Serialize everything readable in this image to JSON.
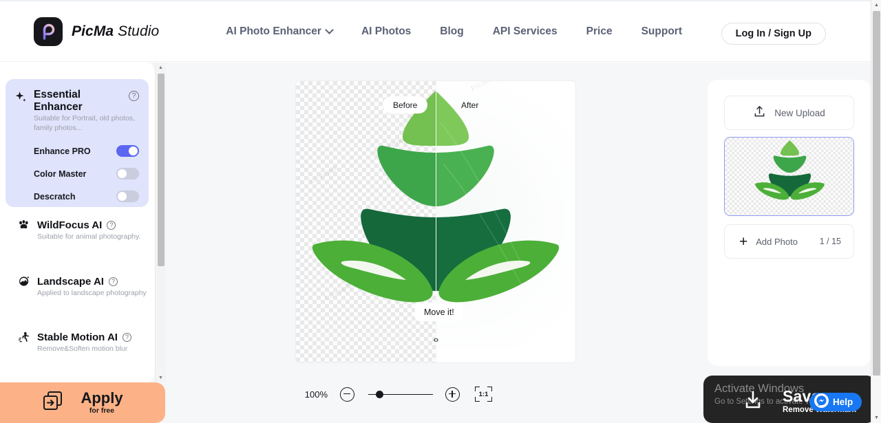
{
  "brand": {
    "name_bold": "PicMa",
    "name_light": "Studio",
    "logo_icon": "picma-p-logo-icon"
  },
  "nav": {
    "items": [
      {
        "label": "AI Photo Enhancer",
        "has_caret": true
      },
      {
        "label": "AI Photos",
        "has_caret": false
      },
      {
        "label": "Blog",
        "has_caret": false
      },
      {
        "label": "API Services",
        "has_caret": false
      },
      {
        "label": "Price",
        "has_caret": false
      },
      {
        "label": "Support",
        "has_caret": false
      }
    ],
    "login_label": "Log In / Sign Up"
  },
  "left_panel": {
    "essential": {
      "title": "Essential Enhancer",
      "subtitle": "Suitable for Portrait, old photos, family photos...",
      "help": "?",
      "toggles": [
        {
          "label": "Enhance PRO",
          "on": true
        },
        {
          "label": "Color Master",
          "on": false
        },
        {
          "label": "Descratch",
          "on": false
        }
      ]
    },
    "modes": [
      {
        "title": "WildFocus AI",
        "subtitle": "Suitable for animal photography.",
        "icon": "paw-icon",
        "help": "?"
      },
      {
        "title": "Landscape AI",
        "subtitle": "Applied to landscape photography",
        "icon": "landscape-sparkle-icon",
        "help": "?"
      },
      {
        "title": "Stable Motion AI",
        "subtitle": "Remove&Soften motion blur",
        "icon": "running-person-icon",
        "help": "?"
      }
    ],
    "apply": {
      "label": "Apply",
      "sub": "for free",
      "icon": "apply-arrow-icon"
    }
  },
  "canvas": {
    "before_label": "Before",
    "after_label": "After",
    "handle_label": "Move it!",
    "handle_arrows": "‹›",
    "watermarks": [
      "Lovepik",
      "Lovepik",
      "Lovepik",
      "Lovepik",
      "PicMa",
      "PicMa"
    ]
  },
  "zoombar": {
    "percent": "100%",
    "zoom_out_icon": "minus-circle-icon",
    "zoom_in_icon": "plus-circle-icon",
    "slider_value": 12,
    "actual_size_label": "1:1"
  },
  "right_panel": {
    "new_upload_label": "New Upload",
    "new_upload_icon": "upload-icon",
    "add_photo_label": "Add Photo",
    "add_photo_count": "1 / 15",
    "add_photo_icon": "plus-icon",
    "thumbnail_name": "leaf-plant-thumbnail"
  },
  "save_bar": {
    "title": "Save",
    "subtitle": "Remove Watermark",
    "icon": "download-icon"
  },
  "windows_activation": {
    "line1": "Activate Windows",
    "line2": "Go to Settings to activate Windows."
  },
  "help_fab": {
    "label": "Help",
    "icon": "messenger-icon"
  },
  "colors": {
    "accent_purple": "#5b67f1",
    "card_lavender": "#dfe3fb",
    "apply_orange": "#fcb286",
    "messenger_blue": "#1877f2",
    "leaf_light": "#74c050",
    "leaf_mid": "#49b04a",
    "leaf_dark": "#1a6b3c",
    "leaf_base": "#4caf38"
  }
}
